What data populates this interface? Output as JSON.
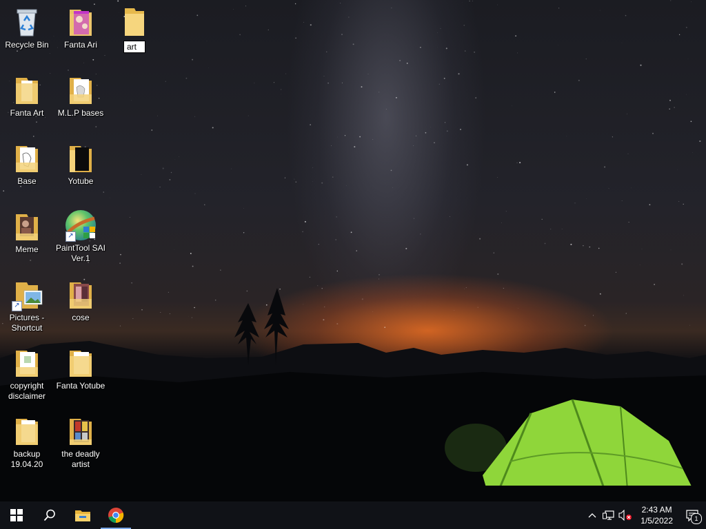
{
  "desktop": {
    "icons": [
      {
        "label": "Recycle Bin",
        "icon": "recycle-bin-icon"
      },
      {
        "label": "Fanta Ari",
        "icon": "folder-icon"
      },
      {
        "label": "art",
        "icon": "folder-icon",
        "renaming": true
      },
      {
        "label": "Fanta Art",
        "icon": "folder-icon"
      },
      {
        "label": "M.L.P bases",
        "icon": "folder-icon"
      },
      {
        "label": "Base",
        "icon": "folder-icon"
      },
      {
        "label": "Yotube",
        "icon": "folder-icon"
      },
      {
        "label": "Meme",
        "icon": "folder-icon"
      },
      {
        "label": "PaintTool SAI Ver.1",
        "icon": "painttool-sai-icon",
        "shortcut": true
      },
      {
        "label": "Pictures - Shortcut",
        "icon": "folder-icon",
        "shortcut": true
      },
      {
        "label": "cose",
        "icon": "folder-icon"
      },
      {
        "label": "copyright disclaimer",
        "icon": "folder-icon"
      },
      {
        "label": "Fanta Yotube",
        "icon": "folder-icon"
      },
      {
        "label": "backup 19.04.20",
        "icon": "folder-icon"
      },
      {
        "label": "the deadly artist",
        "icon": "folder-icon"
      }
    ]
  },
  "taskbar": {
    "start": "windows-start-icon",
    "search": "search-icon",
    "pinned": [
      {
        "name": "file-explorer-icon"
      },
      {
        "name": "chrome-icon",
        "active": true
      }
    ],
    "tray": {
      "chevron": "chevron-up-icon",
      "network": "network-icon",
      "volume": "volume-muted-icon",
      "time": "2:43 AM",
      "date": "1/5/2022",
      "notifications": "1"
    }
  }
}
